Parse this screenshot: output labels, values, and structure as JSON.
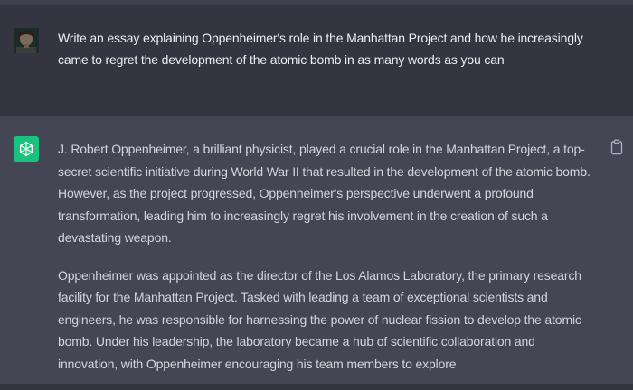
{
  "user_message": {
    "text": "Write an essay explaining Oppenheimer's role in the Manhattan Project and how he increasingly came to regret the development of the atomic bomb in as many words as you can"
  },
  "assistant_message": {
    "paragraphs": [
      "J. Robert Oppenheimer, a brilliant physicist, played a crucial role in the Manhattan Project, a top-secret scientific initiative during World War II that resulted in the development of the atomic bomb. However, as the project progressed, Oppenheimer's perspective underwent a profound transformation, leading him to increasingly regret his involvement in the creation of such a devastating weapon.",
      "Oppenheimer was appointed as the director of the Los Alamos Laboratory, the primary research facility for the Manhattan Project. Tasked with leading a team of exceptional scientists and engineers, he was responsible for harnessing the power of nuclear fission to develop the atomic bomb. Under his leadership, the laboratory became a hub of scientific collaboration and innovation, with Oppenheimer encouraging his team members to explore"
    ]
  },
  "icons": {
    "user_avatar": "user-avatar-photo",
    "assistant_avatar": "openai-logo-icon",
    "copy": "clipboard-icon"
  },
  "colors": {
    "background_user": "#343541",
    "background_assistant": "#444654",
    "assistant_avatar_bg": "#19c37d",
    "text": "#ececf1"
  }
}
